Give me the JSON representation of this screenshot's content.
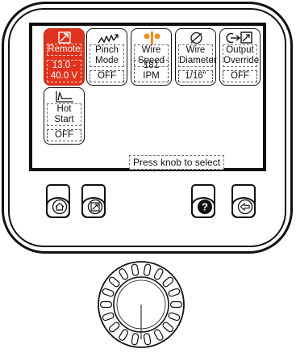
{
  "screen": {
    "tiles": [
      {
        "label": "Remote",
        "value": "13.0 -\n40.0 V",
        "icon": "remote-arrow-icon",
        "active": true
      },
      {
        "label": "Pinch\nMode",
        "value": "OFF",
        "icon": "pinch-icon",
        "active": false
      },
      {
        "label": "Wire\nSpeed",
        "value": "181 IPM",
        "icon": "wire-speed-icon",
        "active": false
      },
      {
        "label": "Wire\nDiameter",
        "value": "1/16\"",
        "icon": "diameter-icon",
        "active": false
      },
      {
        "label": "Output\nOverride",
        "value": "OFF",
        "icon": "output-override-icon",
        "active": false
      },
      {
        "label": "Hot\nStart",
        "value": "OFF",
        "icon": "hot-start-icon",
        "active": false
      }
    ],
    "status_text": "Press knob to select"
  },
  "buttons": [
    {
      "icon": "home-icon"
    },
    {
      "icon": "remote-arrow-icon"
    },
    {
      "icon": "help-icon"
    },
    {
      "icon": "back-icon"
    }
  ],
  "knob": {
    "icon": "rotary-knob-icon"
  },
  "colors": {
    "active_tile": "#e0321c",
    "outline": "#111111",
    "wire_speed_icon": "#f08a1c"
  }
}
